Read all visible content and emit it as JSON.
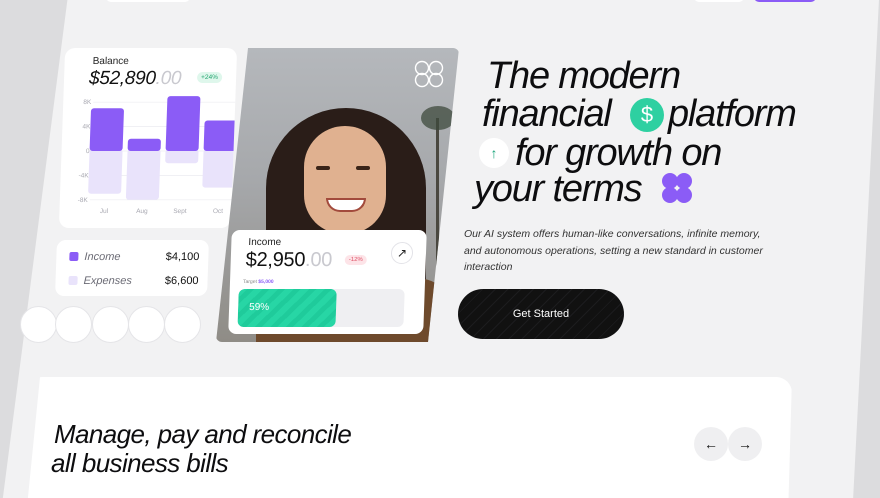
{
  "balance": {
    "label": "Balance",
    "amount": "$52,890",
    "cents": ".00",
    "badge": "+24%",
    "y_ticks": [
      "8K",
      "4K",
      "0",
      "-4K",
      "-8K"
    ],
    "months": [
      "Jul",
      "Aug",
      "Sept",
      "Oct"
    ],
    "income_values": [
      7,
      2,
      9,
      5
    ],
    "expense_values": [
      -7,
      -8,
      -2,
      -6
    ],
    "colors": {
      "income": "#8b5cf6",
      "expense": "#e9e3fb"
    }
  },
  "legend": {
    "income_label": "Income",
    "income_value": "$4,100",
    "expenses_label": "Expenses",
    "expenses_value": "$6,600"
  },
  "income_card": {
    "label": "Income",
    "amount": "$2,950",
    "cents": ".00",
    "badge": "-12%",
    "target_label": "Target",
    "target_value": "$5,000",
    "progress_percent": "59%",
    "progress_fraction": 0.59,
    "arrow": "↗"
  },
  "hero": {
    "line1": "The modern",
    "line2a": "financial",
    "line2b": "platform",
    "line3": "for growth on",
    "line4": "your terms",
    "dollar_icon": "$",
    "up_icon": "↑",
    "description": "Our AI system offers human-like conversations, infinite memory, and autonomous operations, setting a new standard in customer interaction",
    "cta_label": "Get Started"
  },
  "bottom": {
    "title_line1": "Manage, pay and reconcile",
    "title_line2": "all business bills",
    "prev_icon": "←",
    "next_icon": "→"
  },
  "colors": {
    "accent_purple": "#8b5cf6",
    "accent_green": "#2ed0a1",
    "dark": "#111111"
  }
}
